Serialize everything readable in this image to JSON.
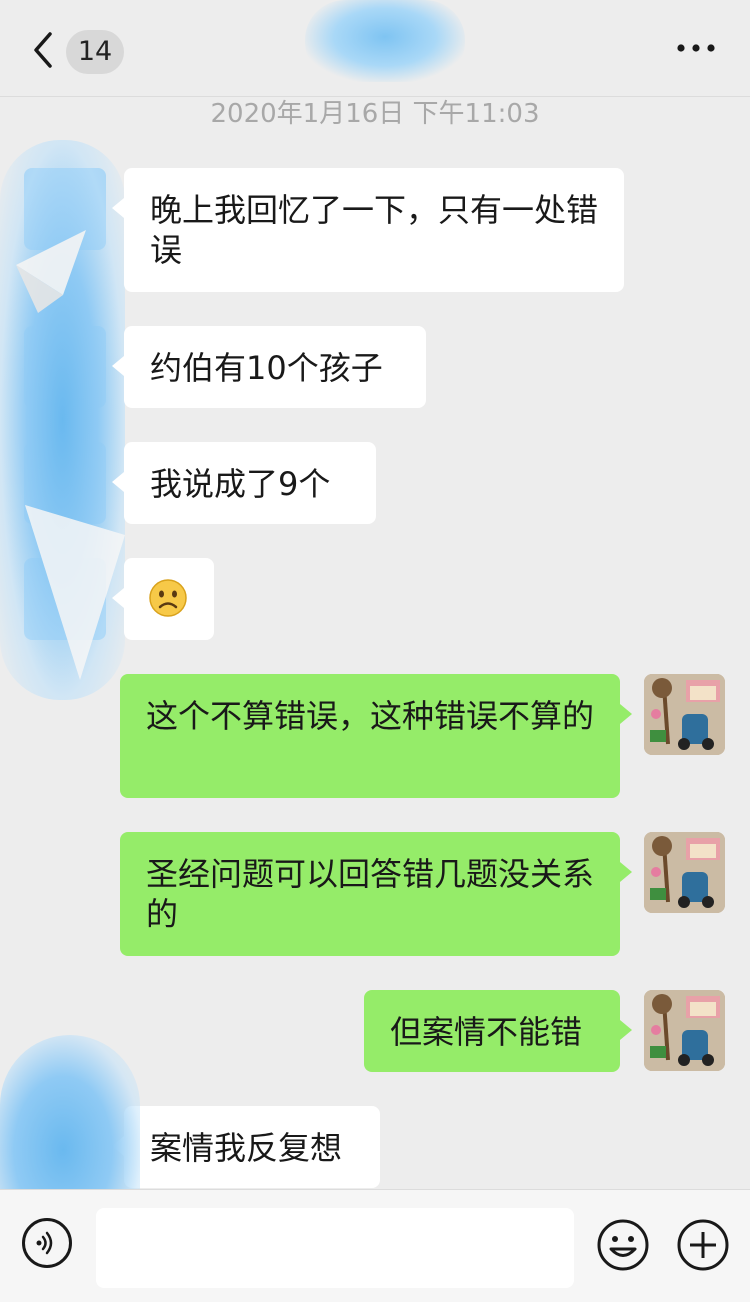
{
  "header": {
    "unread_count": "14"
  },
  "timestamp": "2020年1月16日 下午11:03",
  "messages": [
    {
      "side": "left",
      "text": "晚上我回忆了一下，只有一处错误"
    },
    {
      "side": "left",
      "text": "约伯有10个孩子"
    },
    {
      "side": "left",
      "text": "我说成了9个"
    },
    {
      "side": "left",
      "text": "☹️"
    },
    {
      "side": "right",
      "text": "这个不算错误，这种错误不算的"
    },
    {
      "side": "right",
      "text": "圣经问题可以回答错几题没关系的"
    },
    {
      "side": "right",
      "text": "但案情不能错"
    },
    {
      "side": "left",
      "text": "案情我反复想"
    }
  ],
  "icons": {
    "back": "chevron-left-icon",
    "more": "more-dots-icon",
    "voice": "voice-icon",
    "emoji": "emoji-icon",
    "plus": "plus-icon"
  },
  "colors": {
    "bubble_right": "#95ec69",
    "bubble_left": "#ffffff",
    "background": "#ededed"
  }
}
